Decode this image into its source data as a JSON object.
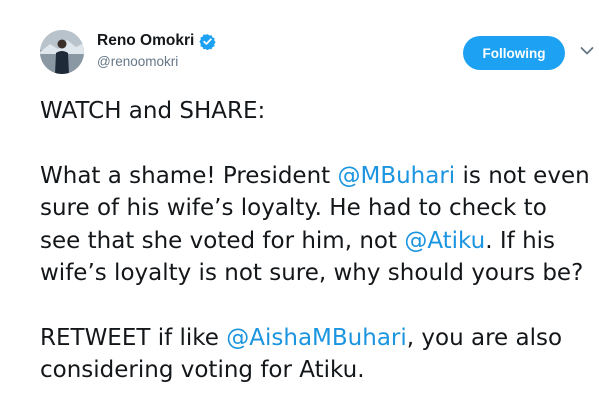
{
  "colors": {
    "accent": "#1da1f2",
    "mention": "#1b95e0",
    "text": "#14171a",
    "muted": "#657786"
  },
  "user": {
    "display_name": "Reno Omokri",
    "handle": "@renoomokri",
    "verified_icon": "verified-badge-icon",
    "avatar_icon": "profile-photo"
  },
  "actions": {
    "follow_label": "Following",
    "menu_icon": "chevron-down-icon"
  },
  "tweet": {
    "p1": "WATCH and SHARE:",
    "p2_a": "What a shame! President ",
    "p2_mention1": "@MBuhari",
    "p2_b": " is not even sure of his wife’s loyalty. He had to check to see that she voted for him, not ",
    "p2_mention2": "@Atiku",
    "p2_c": ". If his wife’s loyalty is not sure, why should yours be?",
    "p3_a": "RETWEET if like ",
    "p3_mention": "@AishaMBuhari",
    "p3_b": ", you are also considering voting for Atiku."
  }
}
